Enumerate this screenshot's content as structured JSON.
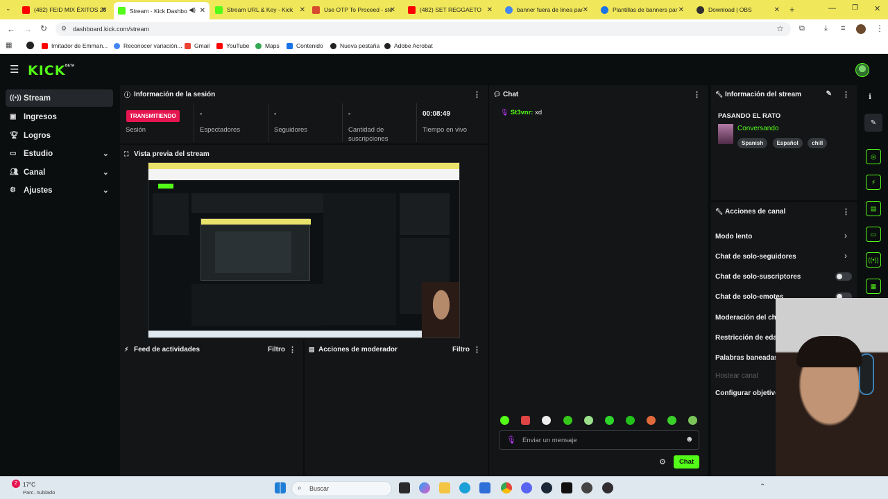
{
  "browser": {
    "tabs": [
      {
        "title": "(482) FEID MIX ÉXITOS 20",
        "color": "#ff0000"
      },
      {
        "title": "Stream - Kick Dashbo",
        "color": "#53fc18",
        "active": true
      },
      {
        "title": "Stream URL & Key - Kick",
        "color": "#53fc18"
      },
      {
        "title": "Use OTP To Proceed - ste",
        "color": "#d84a2e"
      },
      {
        "title": "(482) SET REGGAETO",
        "color": "#ff0000"
      },
      {
        "title": "banner fuera de linea par",
        "color": "#4285f4"
      },
      {
        "title": "Plantillas de banners par",
        "color": "#1a73e8"
      },
      {
        "title": "Download | OBS",
        "color": "#302e31"
      }
    ],
    "url": "dashboard.kick.com/stream",
    "bookmarks": [
      "Imitador de Emman...",
      "Reconocer variación...",
      "Gmail",
      "YouTube",
      "Maps",
      "Contenido",
      "Nueva pestaña",
      "Adobe Acrobat"
    ]
  },
  "app": {
    "logo": "KICK",
    "beta": "BETA",
    "sidebar": [
      {
        "label": "Stream",
        "icon": "stream-icon"
      },
      {
        "label": "Ingresos",
        "icon": "wallet-icon"
      },
      {
        "label": "Logros",
        "icon": "trophy-icon"
      },
      {
        "label": "Estudio",
        "icon": "monitor-icon"
      },
      {
        "label": "Canal",
        "icon": "users-icon"
      },
      {
        "label": "Ajustes",
        "icon": "gear-icon"
      }
    ],
    "session": {
      "title": "Información de la sesión",
      "live_badge": "TRANSMITIENDO",
      "session_label": "Sesión",
      "viewers_value": "-",
      "viewers_label": "Espectadores",
      "followers_value": "-",
      "followers_label": "Seguidores",
      "subs_value": "-",
      "subs_label": "Cantidad de suscripciones",
      "time_value": "00:08:49",
      "time_label": "Tiempo en vivo"
    },
    "preview": {
      "title": "Vista previa del stream"
    },
    "feed": {
      "title": "Feed de actividades",
      "filter": "Filtro"
    },
    "mod": {
      "title": "Acciones de moderador",
      "filter": "Filtro"
    },
    "chat": {
      "title": "Chat",
      "messages": [
        {
          "user": "St3vnr:",
          "text": "xd"
        }
      ],
      "input_placeholder": "Enviar un mensaje",
      "send_label": "Chat"
    },
    "stream_info": {
      "title": "Información del stream",
      "stream_title": "PASANDO EL RATO",
      "category": "Conversando",
      "tags": [
        "Spanish",
        "Español",
        "chill"
      ]
    },
    "channel_actions": {
      "title": "Acciones de canal",
      "items": [
        {
          "label": "Modo lento",
          "kind": "chevron"
        },
        {
          "label": "Chat de solo-seguidores",
          "kind": "chevron"
        },
        {
          "label": "Chat de solo-suscriptores",
          "kind": "toggle"
        },
        {
          "label": "Chat de solo-emotes",
          "kind": "toggle"
        },
        {
          "label": "Moderación del cha",
          "kind": "none"
        },
        {
          "label": "Restricción de edad",
          "kind": "none"
        },
        {
          "label": "Palabras baneadas",
          "kind": "none"
        },
        {
          "label": "Hostear canal",
          "kind": "disabled"
        },
        {
          "label": "Configurar objetivo",
          "kind": "none"
        }
      ]
    }
  },
  "taskbar": {
    "weather_temp": "17°C",
    "weather_desc": "Parc. nublado",
    "search_placeholder": "Buscar",
    "badge": "2"
  }
}
